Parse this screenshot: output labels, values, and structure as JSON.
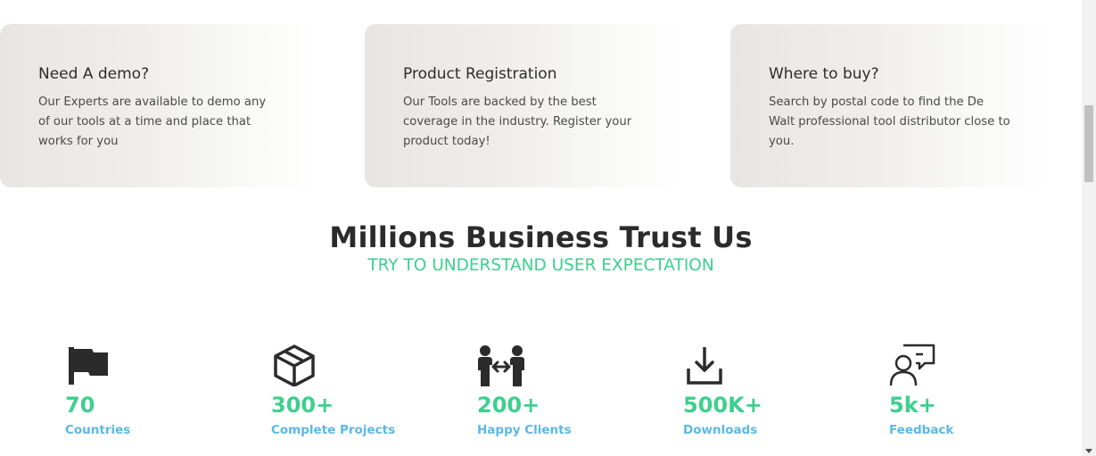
{
  "cards": [
    {
      "title": "Need A demo?",
      "description": "Our Experts are available to demo any of our tools at a time and place that works for you"
    },
    {
      "title": "Product Registration",
      "description": "Our Tools are backed by the best coverage in the industry. Register your product today!"
    },
    {
      "title": "Where to buy?",
      "description": "Search by postal code to find the De Walt professional tool distributor close to you."
    }
  ],
  "section": {
    "heading": "Millions Business Trust Us",
    "subheading": "TRY TO UNDERSTAND USER EXPECTATION"
  },
  "stats": [
    {
      "icon": "flag-icon",
      "value": "70",
      "label": "Countries"
    },
    {
      "icon": "box-icon",
      "value": "300+",
      "label": "Complete Projects"
    },
    {
      "icon": "handshake-users-icon",
      "value": "200+",
      "label": "Happy Clients"
    },
    {
      "icon": "download-icon",
      "value": "500K+",
      "label": "Downloads"
    },
    {
      "icon": "feedback-icon",
      "value": "5k+",
      "label": "Feedback"
    }
  ],
  "colors": {
    "accent_green": "#3ecf8e",
    "accent_blue": "#5cb8e6",
    "heading": "#2b2b2b"
  }
}
